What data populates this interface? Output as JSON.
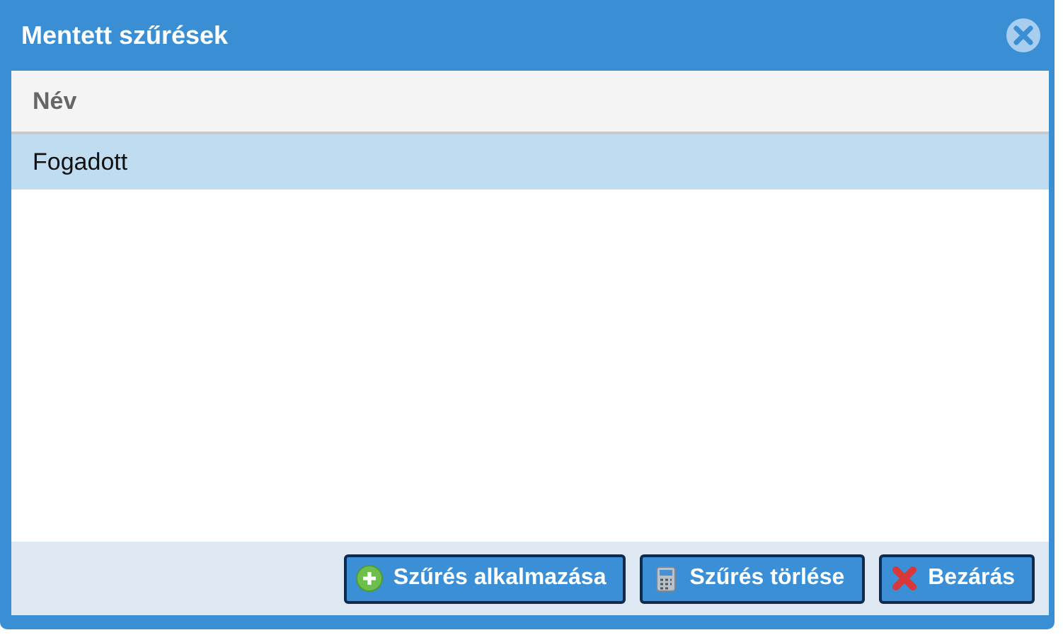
{
  "window": {
    "title": "Mentett szűrések"
  },
  "table": {
    "columns": [
      "Név"
    ],
    "rows": [
      {
        "cells": [
          "Fogadott"
        ],
        "selected": true
      }
    ]
  },
  "buttons": [
    {
      "label": "Szűrés alkalmazása",
      "kind": "add"
    },
    {
      "label": "Szűrés törlése",
      "kind": "clear"
    },
    {
      "label": "Bezárás",
      "kind": "close"
    }
  ]
}
